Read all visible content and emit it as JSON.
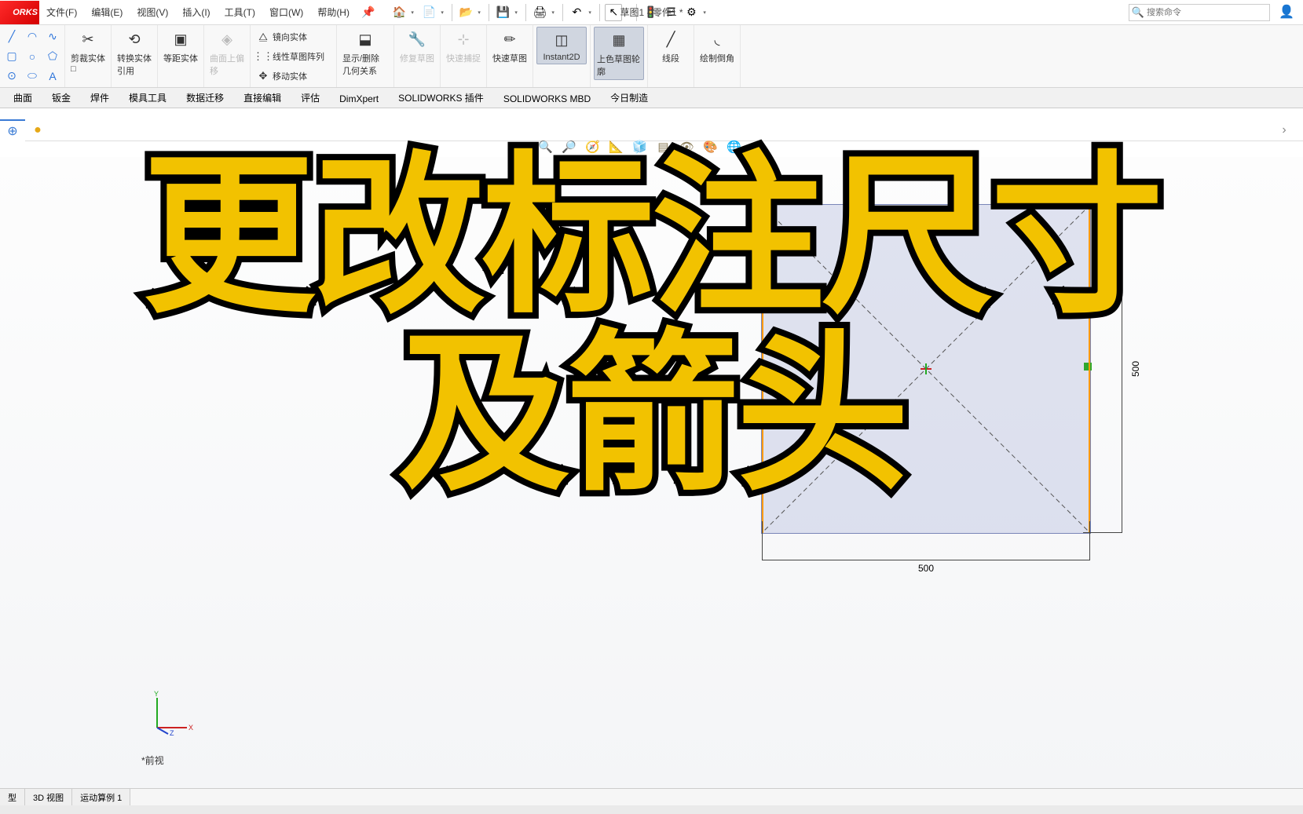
{
  "logo": "ORKS",
  "doc_title": "草图1 - 零件1 *",
  "menus": [
    "文件(F)",
    "编辑(E)",
    "视图(V)",
    "插入(I)",
    "工具(T)",
    "窗口(W)",
    "帮助(H)"
  ],
  "search_placeholder": "搜索命令",
  "ribbon": {
    "trim": "剪裁实体□",
    "convert": "转换实体引用",
    "offset": "等距实体",
    "surf_offset": "曲面上偏移",
    "mirror": "镜向实体",
    "pattern": "线性草图阵列",
    "move": "移动实体",
    "show_rel": "显示/删除几何关系",
    "repair": "修复草图",
    "quick_snap": "快速捕捉",
    "quick_sketch": "快速草图",
    "instant2d": "Instant2D",
    "shade": "上色草图轮廓",
    "line_seg": "线段",
    "fillet": "绘制倒角"
  },
  "ctx_tabs": [
    "曲面",
    "钣金",
    "焊件",
    "模具工具",
    "数据迁移",
    "直接编辑",
    "评估",
    "DimXpert",
    "SOLIDWORKS 插件",
    "SOLIDWORKS MBD",
    "今日制造"
  ],
  "dimensions": {
    "w": "500",
    "h": "500"
  },
  "front_view": "*前视",
  "bottom_tabs": [
    "型",
    "3D 视图",
    "运动算例 1"
  ],
  "overlay": {
    "line1": "更改标注尺寸",
    "line2": "及箭头"
  }
}
